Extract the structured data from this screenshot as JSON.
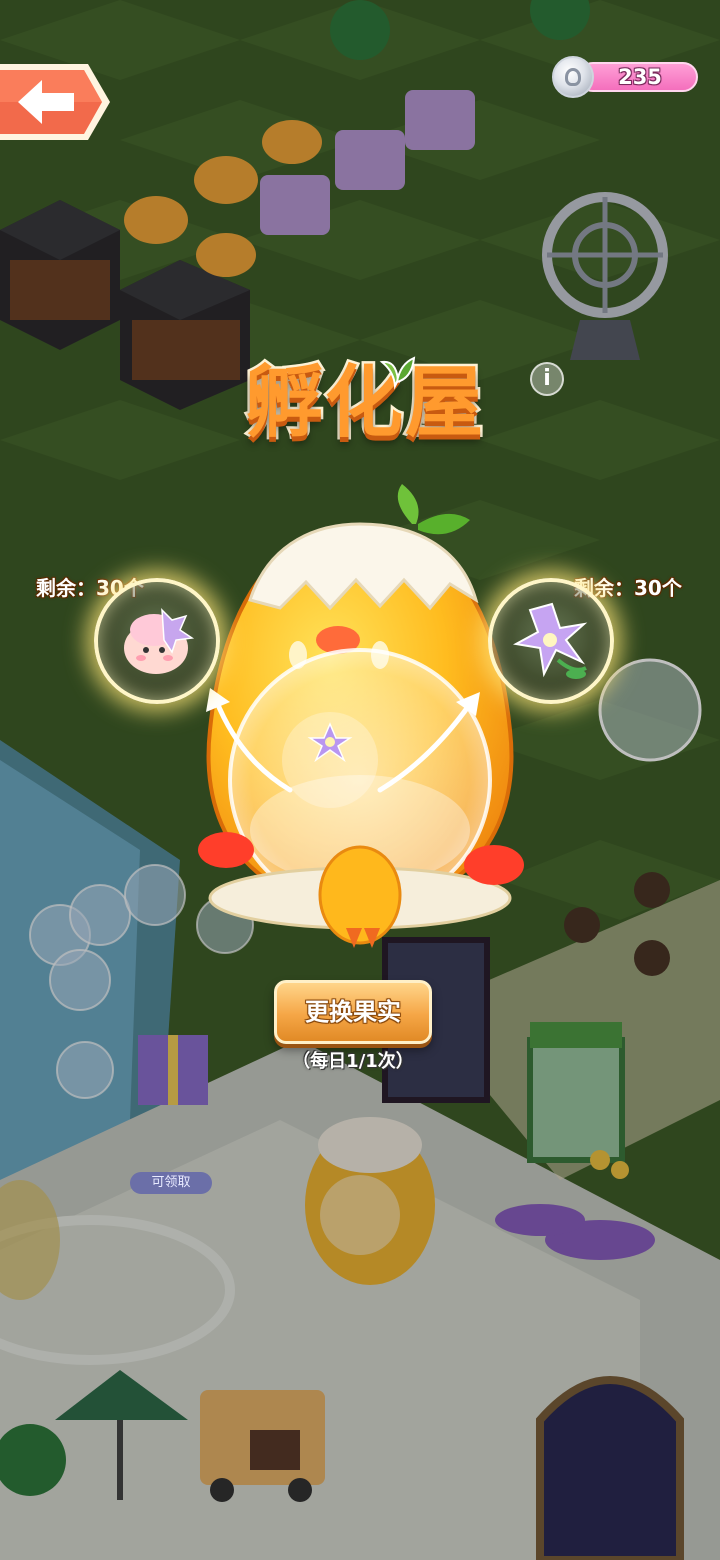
{
  "header": {
    "back_icon": "back-arrow-icon",
    "currency": {
      "icon": "silver-coin-icon",
      "value": "235"
    }
  },
  "panel": {
    "title": "孵化屋",
    "info_icon": "info-icon",
    "info_label": "i",
    "left_slot": {
      "remaining_label": "剩余：30个",
      "item_icon": "pink-fluffy-creature-icon"
    },
    "right_slot": {
      "remaining_label": "剩余：30个",
      "item_icon": "purple-flower-icon"
    },
    "machine": {
      "icon": "chick-hatch-machine",
      "current_fruit_icon": "purple-flower-icon"
    },
    "swap_button_label": "更换果实",
    "daily_limit_label": "（每日1/1次）"
  },
  "scene": {
    "claim_tag_label": "可领取"
  },
  "colors": {
    "title_orange": "#ff9a2e",
    "button_orange": "#f5a646",
    "coin_pink": "#f46fbd",
    "back_button": "#f26a4b",
    "grass": "#3c5a26"
  }
}
